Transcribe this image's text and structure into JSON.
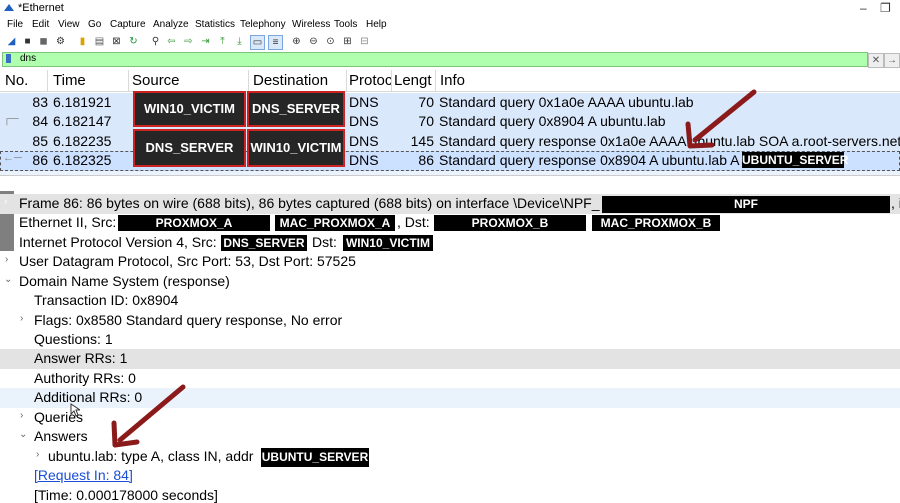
{
  "window": {
    "title": "*Ethernet",
    "minimize": "–",
    "restore": "❐"
  },
  "menu": [
    "File",
    "Edit",
    "View",
    "Go",
    "Capture",
    "Analyze",
    "Statistics",
    "Telephony",
    "Wireless",
    "Tools",
    "Help"
  ],
  "filter": {
    "value": "dns",
    "clear": "✕",
    "apply": "→"
  },
  "columns": [
    "No.",
    "Time",
    "Source",
    "Destination",
    "Protocol",
    "Length",
    "Info"
  ],
  "columns_visible": [
    "No.",
    "Time",
    "Source",
    "Destination",
    "Protoc",
    "Lengt",
    "Info"
  ],
  "packets": [
    {
      "no": "83",
      "time": "6.181921",
      "source": "WIN10_VICTIM",
      "destination": "DNS_SERVER",
      "protocol": "DNS",
      "length": "70",
      "info": "Standard query 0x1a0e AAAA ubuntu.lab"
    },
    {
      "no": "84",
      "time": "6.182147",
      "source": "",
      "destination": "",
      "protocol": "DNS",
      "length": "70",
      "info": "Standard query 0x8904 A ubuntu.lab"
    },
    {
      "no": "85",
      "time": "6.182235",
      "source": "DNS_SERVER",
      "destination": "WIN10_VICTIM",
      "protocol": "DNS",
      "length": "145",
      "info": "Standard query response 0x1a0e AAAA ubuntu.lab SOA a.root-servers.net"
    },
    {
      "no": "86",
      "time": "6.182325",
      "source": "",
      "destination": "",
      "protocol": "DNS",
      "length": "86",
      "info": "Standard query response 0x8904 A ubuntu.lab A"
    }
  ],
  "redactions": {
    "win10": "WIN10_VICTIM",
    "dns_server": "DNS_SERVER",
    "ubuntu_server": "UBUNTU_SERVER",
    "npf": "NPF",
    "proxmox_a": "PROXMOX_A",
    "mac_proxmox_a": "MAC_PROXMOX_A",
    "proxmox_b": "PROXMOX_B",
    "mac_proxmox_b": "MAC_PROXMOX_B"
  },
  "details": {
    "frame": "Frame 86: 86 bytes on wire (688 bits), 86 bytes captured (688 bits) on interface \\Device\\NPF_",
    "frame_tail": ", i",
    "ethernet_prefix": "Ethernet II, Src: ",
    "ethernet_dst": ", Dst: ",
    "ip_prefix": "Internet Protocol Version 4, Src: ",
    "ip_dst": "Dst: ",
    "udp": "User Datagram Protocol, Src Port: 53, Dst Port: 57525",
    "dns": "Domain Name System (response)",
    "txid": "Transaction ID: 0x8904",
    "flags": "Flags: 0x8580 Standard query response, No error",
    "questions": "Questions: 1",
    "answer_rrs": "Answer RRs: 1",
    "authority_rrs": "Authority RRs: 0",
    "additional_rrs": "Additional RRs: 0",
    "queries": "Queries",
    "answers": "Answers",
    "answer_entry": "ubuntu.lab: type A, class IN, addr",
    "request_in": "[Request In: 84]",
    "time": "[Time: 0.000178000 seconds]"
  },
  "colors": {
    "filter_bg": "#afffaf",
    "row_highlight": "#dae8fc",
    "annotation_arrow": "#8b1a1a"
  }
}
